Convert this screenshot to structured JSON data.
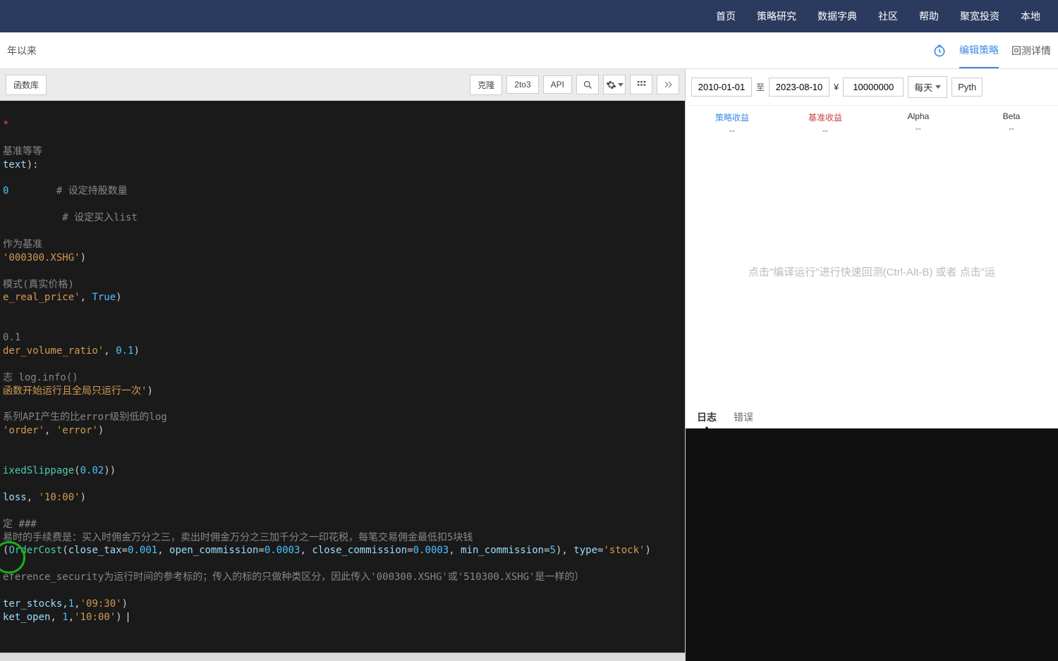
{
  "topnav": [
    "首页",
    "策略研究",
    "数据字典",
    "社区",
    "帮助",
    "聚宽投资",
    "本地"
  ],
  "subbar": {
    "left": "年以来",
    "edit": "编辑策略",
    "backtest": "回测详情"
  },
  "toolbar": {
    "lib": "函数库",
    "clone": "克隆",
    "t2to3": "2to3",
    "api": "API"
  },
  "params": {
    "start": "2010-01-01",
    "to": "至",
    "end": "2023-08-10",
    "currency": "¥",
    "capital": "10000000",
    "freq": "每天",
    "lang": "Pyth"
  },
  "metrics": [
    {
      "name": "策略收益",
      "val": "--",
      "cls": "blue"
    },
    {
      "name": "基准收益",
      "val": "--",
      "cls": "red"
    },
    {
      "name": "Alpha",
      "val": "--",
      "cls": ""
    },
    {
      "name": "Beta",
      "val": "--",
      "cls": ""
    }
  ],
  "chart_hint": "点击\"编译运行\"进行快速回测(Ctrl-Alt-B) 或者 点击\"运",
  "logtabs": {
    "logs": "日志",
    "errs": "错误"
  },
  "code": {
    "l1": "*",
    "l3": "基准等等",
    "l4a": "text",
    "l4b": "):",
    "l6a": "0",
    "l6b": "# 设定持股数量",
    "l8": "# 设定买入list",
    "l10": "作为基准",
    "l11a": "'000300.XSHG'",
    "l11b": ")",
    "l13": "模式(真实价格)",
    "l14a": "e_real_price'",
    "l14b": ", ",
    "l14c": "True",
    "l14d": ")",
    "l17a": "0.1",
    "l18a": "der_volume_ratio'",
    "l18b": ", ",
    "l18c": "0.1",
    "l18d": ")",
    "l20a": "志 log.info()",
    "l21a": "函数开始运行且全局只运行一次'",
    "l21b": ")",
    "l23": "系列API产生的比error级别低的log",
    "l24a": "'order'",
    "l24b": ", ",
    "l24c": "'error'",
    "l24d": ")",
    "l27a": "ixedSlippage",
    "l27b": "(",
    "l27c": "0.02",
    "l27d": "))",
    "l29a": "loss",
    "l29b": ", ",
    "l29c": "'10:00'",
    "l29d": ")",
    "l31": "定 ###",
    "l32": "易时的手续费是：买入时佣金万分之三，卖出时佣金万分之三加千分之一印花税，每笔交易佣金最低扣5块钱",
    "l33a": "(",
    "l33b": "OrderCost",
    "l33c": "(",
    "l33d": "close_tax",
    "l33e": "=",
    "l33f": "0.001",
    "l33g": ", ",
    "l33h": "open_commission",
    "l33i": "=",
    "l33j": "0.0003",
    "l33k": ", ",
    "l33l": "close_commission",
    "l33m": "=",
    "l33n": "0.0003",
    "l33o": ", ",
    "l33p": "min_commission",
    "l33q": "=",
    "l33r": "5",
    "l33s": "), ",
    "l33t": "type",
    "l33u": "=",
    "l33v": "'stock'",
    "l33w": ")",
    "l35": "eference_security为运行时间的参考标的；传入的标的只做种类区分，因此传入'000300.XSHG'或'510300.XSHG'是一样的）",
    "l37a": "ter_stocks,",
    "l37b": "1",
    "l37c": ",",
    "l37d": "'09:30'",
    "l37e": ")",
    "l38a": "ket_open",
    "l38b": ", ",
    "l38c": "1",
    "l38d": ",",
    "l38e": "'10:00'",
    "l38f": ") "
  }
}
